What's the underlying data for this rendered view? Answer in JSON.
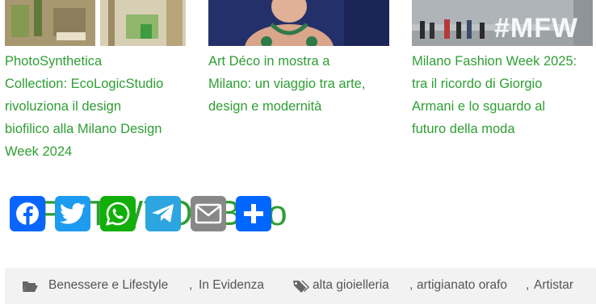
{
  "related_posts": [
    {
      "title": "PhotoSynthetica Collection: EcoLogicStudio rivoluziona il design biofilico alla Milano Design Week 2024",
      "lines": [
        "PhotoSynthetica",
        "Collection: EcoLogicStudio",
        "rivoluziona il design",
        "biofilico alla Milano Design",
        "Week 2024"
      ]
    },
    {
      "title": "Art Déco in mostra a Milano: un viaggio tra arte, design e modernità",
      "lines": [
        "Art Déco in mostra a",
        "Milano: un viaggio tra arte,",
        "design e modernità"
      ]
    },
    {
      "title": "Milano Fashion Week 2025: tra il ricordo di Giorgio Armani e lo sguardo al futuro della moda",
      "lines": [
        "Milano Fashion Week 2025:",
        "tra il ricordo di Giorgio",
        "Armani e lo sguardo al",
        "futuro della moda"
      ],
      "image_text": "#MFW"
    }
  ],
  "share": {
    "ghost_text": "OPPTWTOEBCo",
    "buttons": [
      {
        "name": "Facebook",
        "icon": "facebook-icon",
        "color": "#0866ff"
      },
      {
        "name": "Twitter",
        "icon": "twitter-icon",
        "color": "#1d9bf0"
      },
      {
        "name": "WhatsApp",
        "icon": "whatsapp-icon",
        "color": "#12af0a"
      },
      {
        "name": "Telegram",
        "icon": "telegram-icon",
        "color": "#2ca5e0"
      },
      {
        "name": "Email",
        "icon": "email-icon",
        "color": "#888888"
      },
      {
        "name": "Share",
        "icon": "plus-icon",
        "color": "#0166ff"
      }
    ]
  },
  "meta": {
    "categories": [
      "Benessere e Lifestyle",
      "In Evidenza"
    ],
    "separator": ",",
    "tags": [
      "alta gioielleria",
      "artigianato orafo",
      "Artistar"
    ],
    "category_icon": "folder-open-icon",
    "tag_icon": "tags-icon"
  }
}
